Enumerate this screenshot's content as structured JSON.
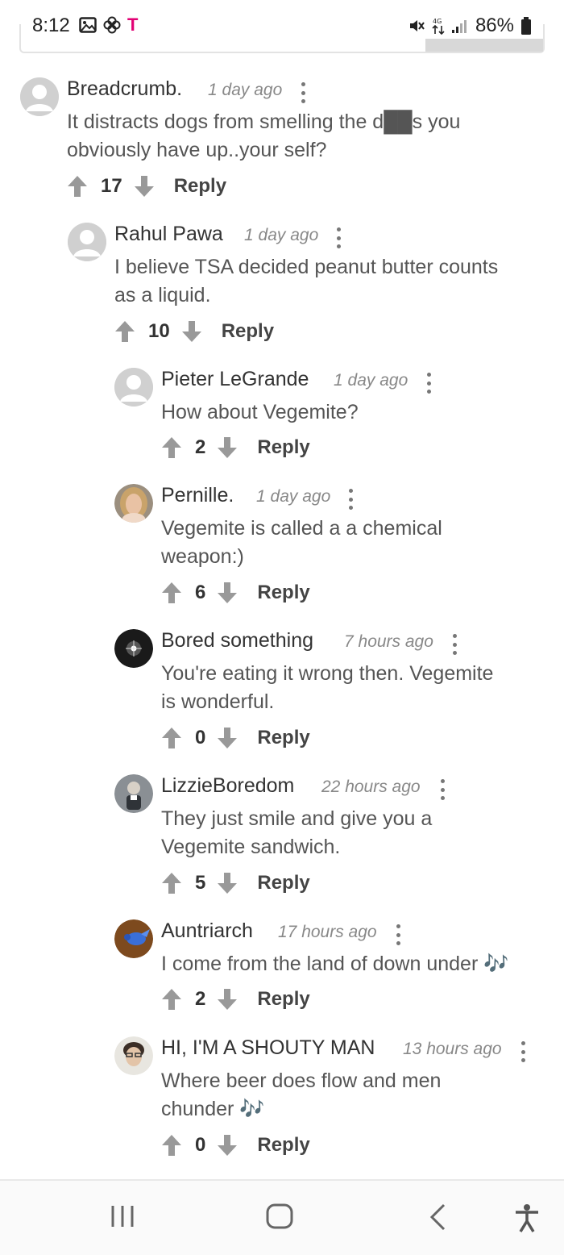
{
  "status_bar": {
    "time": "8:12",
    "carrier": "T",
    "battery": "86%",
    "icons": [
      "gallery-icon",
      "pinwheel-icon",
      "mute-icon",
      "data-icon",
      "signal-icon",
      "battery-icon"
    ]
  },
  "comments": [
    {
      "author": "Breadcrumb.",
      "time": "1 day ago",
      "body_lines": [
        "It distracts dogs from smelling the d██s you",
        "obviously have up..your self?"
      ],
      "votes": "17",
      "reply": "Reply",
      "avatar": "placeholder"
    },
    {
      "author": "Rahul Pawa",
      "time": "1 day ago",
      "body_lines": [
        "I believe TSA decided peanut butter counts",
        "as a liquid."
      ],
      "votes": "10",
      "reply": "Reply",
      "avatar": "placeholder"
    },
    {
      "author": "Pieter LeGrande",
      "time": "1 day ago",
      "body_lines": [
        "How about Vegemite?"
      ],
      "votes": "2",
      "reply": "Reply",
      "avatar": "placeholder"
    },
    {
      "author": "Pernille.",
      "time": "1 day ago",
      "body_lines": [
        "Vegemite is called a a chemical",
        "weapon:)"
      ],
      "votes": "6",
      "reply": "Reply",
      "avatar": "photo-blonde"
    },
    {
      "author": "Bored something",
      "time": "7 hours ago",
      "body_lines": [
        "You're eating it wrong then. Vegemite",
        "is wonderful."
      ],
      "votes": "0",
      "reply": "Reply",
      "avatar": "photo-dark"
    },
    {
      "author": "LizzieBoredom",
      "time": "22 hours ago",
      "body_lines": [
        "They just smile and give you a",
        "Vegemite sandwich."
      ],
      "votes": "5",
      "reply": "Reply",
      "avatar": "photo-figure"
    },
    {
      "author": "Auntriarch",
      "time": "17 hours ago",
      "body_lines": [
        "I come from the land of down under 🎶"
      ],
      "votes": "2",
      "reply": "Reply",
      "avatar": "photo-blue"
    },
    {
      "author": "HI, I'M A SHOUTY MAN",
      "time": "13 hours ago",
      "body_lines": [
        "Where beer does flow and men",
        "chunder 🎶"
      ],
      "votes": "0",
      "reply": "Reply",
      "avatar": "photo-face"
    }
  ],
  "nav_bar": {
    "items": [
      "recents-icon",
      "home-icon",
      "back-icon",
      "accessibility-icon"
    ]
  }
}
